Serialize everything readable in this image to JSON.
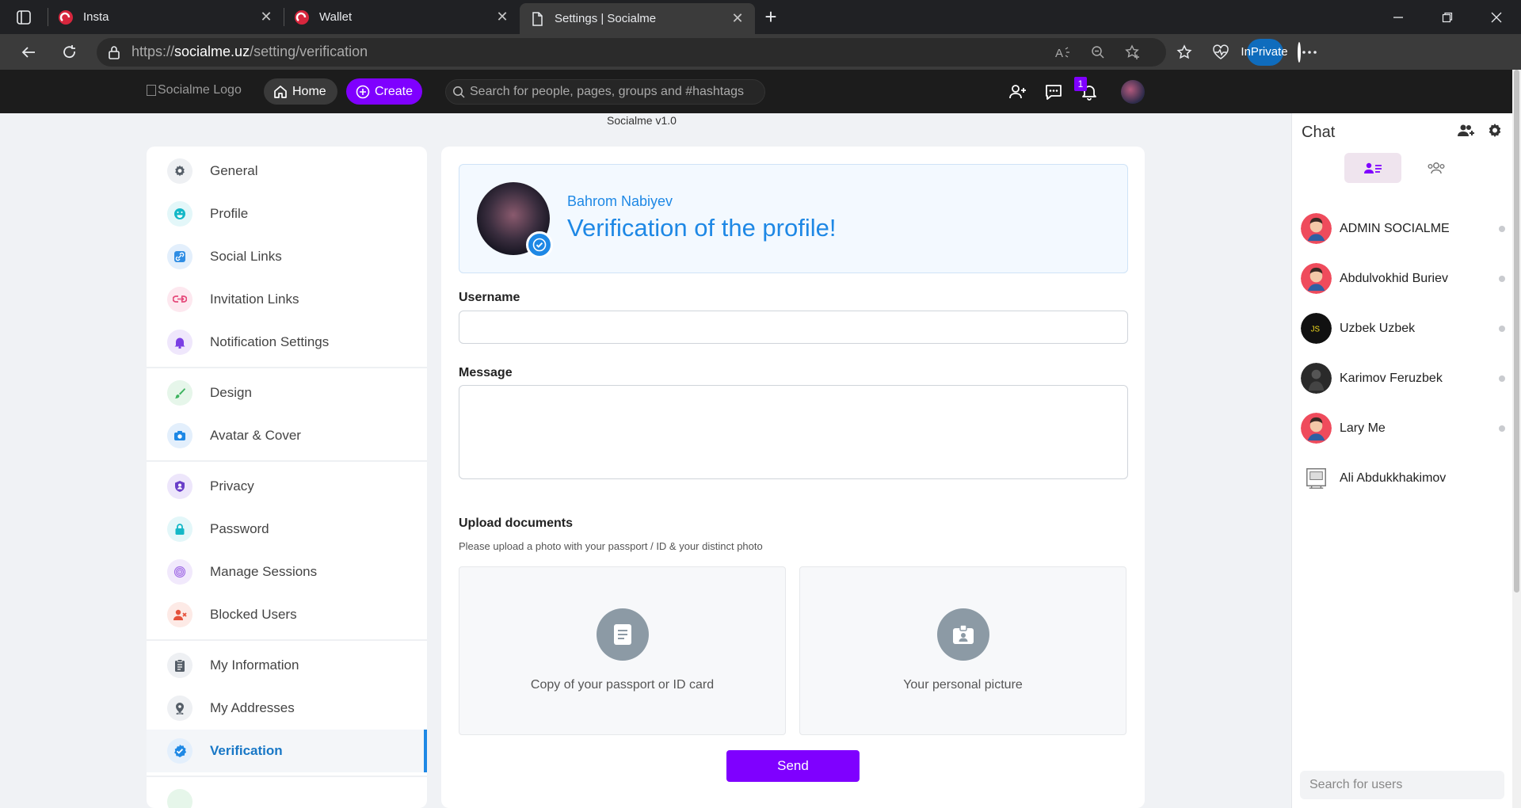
{
  "browser": {
    "tabs": [
      {
        "label": "Insta"
      },
      {
        "label": "Wallet"
      },
      {
        "label": "Settings | Socialme"
      }
    ],
    "url_prefix": "https://",
    "url_host": "socialme.uz",
    "url_path": "/setting/verification",
    "inprivate_label": "InPrivate"
  },
  "header": {
    "logo_alt": "Socialme Logo",
    "home_label": "Home",
    "create_label": "Create",
    "search_placeholder": "Search for people, pages, groups and #hashtags",
    "notification_count": "1"
  },
  "version": "Socialme v1.0",
  "settings_nav": [
    {
      "label": "General",
      "icon": "gear-icon",
      "color": "#555e68",
      "bg": "#eef0f3"
    },
    {
      "label": "Profile",
      "icon": "smile-icon",
      "color": "#14b8c7",
      "bg": "#e3f7f9"
    },
    {
      "label": "Social Links",
      "icon": "link-icon",
      "color": "#2f8de4",
      "bg": "#e3effc"
    },
    {
      "label": "Invitation Links",
      "icon": "invite-icon",
      "color": "#e5497a",
      "bg": "#fde8ef"
    },
    {
      "label": "Notification Settings",
      "icon": "bell-icon",
      "color": "#7b3fe4",
      "bg": "#efe7fc"
    },
    {
      "label": "Design",
      "icon": "brush-icon",
      "color": "#3db35f",
      "bg": "#e6f6ea"
    },
    {
      "label": "Avatar & Cover",
      "icon": "camera-icon",
      "color": "#1e88e5",
      "bg": "#e3effc"
    },
    {
      "label": "Privacy",
      "icon": "shield-icon",
      "color": "#6a3fc9",
      "bg": "#ede6fb"
    },
    {
      "label": "Password",
      "icon": "lock-icon",
      "color": "#14b8c7",
      "bg": "#e3f7f9"
    },
    {
      "label": "Manage Sessions",
      "icon": "fingerprint-icon",
      "color": "#a26ee6",
      "bg": "#f1e9fc"
    },
    {
      "label": "Blocked Users",
      "icon": "block-user-icon",
      "color": "#e5533d",
      "bg": "#fdeae6"
    },
    {
      "label": "My Information",
      "icon": "clipboard-icon",
      "color": "#555e68",
      "bg": "#eef0f3"
    },
    {
      "label": "My Addresses",
      "icon": "location-icon",
      "color": "#555e68",
      "bg": "#eef0f3"
    },
    {
      "label": "Verification",
      "icon": "verified-icon",
      "color": "#1e88e5",
      "bg": "#e3effc"
    }
  ],
  "verification": {
    "user_name": "Bahrom Nabiyev",
    "title": "Verification of the profile!",
    "username_label": "Username",
    "username_value": "",
    "message_label": "Message",
    "message_value": "",
    "upload_label": "Upload documents",
    "upload_hint": "Please upload a photo with your passport / ID & your distinct photo",
    "upload_passport": "Copy of your passport or ID card",
    "upload_photo": "Your personal picture",
    "send_label": "Send"
  },
  "chat": {
    "title": "Chat",
    "search_placeholder": "Search for users",
    "users": [
      {
        "name": "ADMIN SOCIALME",
        "avatar": "red-person"
      },
      {
        "name": "Abdulvokhid Buriev",
        "avatar": "red-person"
      },
      {
        "name": "Uzbek Uzbek",
        "avatar": "js-logo"
      },
      {
        "name": "Karimov Feruzbek",
        "avatar": "dark-photo"
      },
      {
        "name": "Lary Me",
        "avatar": "red-person"
      },
      {
        "name": "Ali Abdukkhakimov",
        "avatar": "pixel-photo"
      }
    ]
  },
  "colors": {
    "accent": "#7f00ff",
    "primary": "#1e88e5"
  }
}
